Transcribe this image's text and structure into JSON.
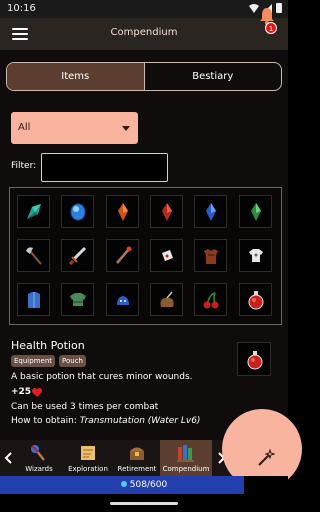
{
  "status": {
    "time": "10:16"
  },
  "appbar": {
    "title": "Compendium",
    "notification_count": "1"
  },
  "tabs": [
    {
      "label": "Items",
      "active": true
    },
    {
      "label": "Bestiary",
      "active": false
    }
  ],
  "category_select": {
    "value": "All"
  },
  "filter": {
    "label": "Filter:",
    "value": ""
  },
  "grid_items": [
    {
      "name": "teal-crystal-icon"
    },
    {
      "name": "blue-gem-icon"
    },
    {
      "name": "orange-crystal-icon"
    },
    {
      "name": "red-crystal-icon"
    },
    {
      "name": "blue-crystal-icon"
    },
    {
      "name": "green-crystal-icon"
    },
    {
      "name": "axe-icon"
    },
    {
      "name": "sword-icon"
    },
    {
      "name": "staff-icon"
    },
    {
      "name": "scroll-icon"
    },
    {
      "name": "leather-armor-icon"
    },
    {
      "name": "white-shirt-icon"
    },
    {
      "name": "blue-robe-icon"
    },
    {
      "name": "green-tunic-icon"
    },
    {
      "name": "blue-slime-icon"
    },
    {
      "name": "pouch-icon"
    },
    {
      "name": "cherries-icon"
    },
    {
      "name": "health-potion-icon"
    }
  ],
  "detail": {
    "title": "Health Potion",
    "tags": [
      "Equipment",
      "Pouch"
    ],
    "description": "A basic potion that cures minor wounds.",
    "stat": "+25",
    "stat_icon": "heart-icon",
    "uses": "Can be used 3 times per combat",
    "obtain_prefix": "How to obtain: ",
    "obtain_value": "Transmutation (Water Lv6)"
  },
  "nav": [
    {
      "label": "Wizards",
      "icon": "wizard-staff-icon",
      "active": false
    },
    {
      "label": "Exploration",
      "icon": "map-scroll-icon",
      "active": false
    },
    {
      "label": "Retirement",
      "icon": "treasure-chest-icon",
      "active": false
    },
    {
      "label": "Compendium",
      "icon": "books-icon",
      "active": true
    }
  ],
  "fab_icon": "magic-wand-icon",
  "mana": {
    "text": "508/600",
    "current": 508,
    "max": 600
  },
  "colors": {
    "accent": "#f9b4a0",
    "active_tab": "#5c3e31",
    "mana": "#233fae"
  }
}
